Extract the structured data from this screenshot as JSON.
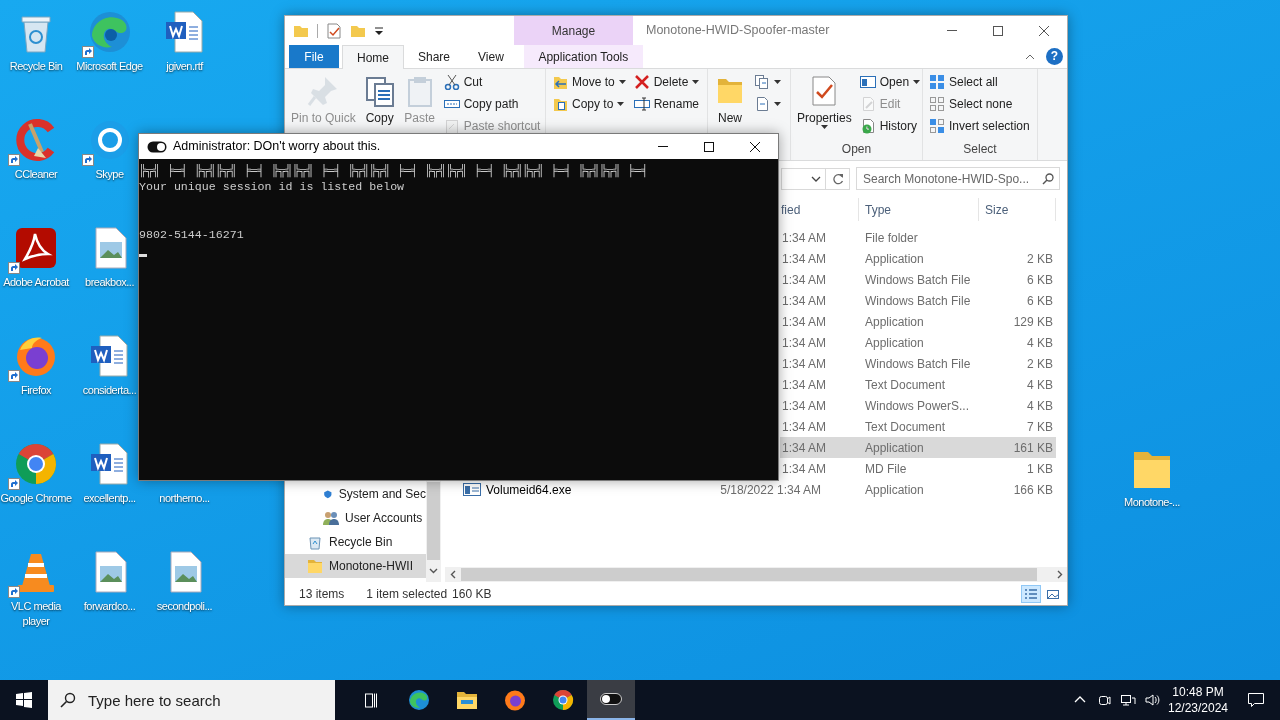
{
  "desktop_columns": [
    [
      {
        "label": "Recycle Bin",
        "kind": "recycle",
        "shortcut": false
      },
      {
        "label": "CCleaner",
        "kind": "ccleaner",
        "shortcut": true
      },
      {
        "label": "Adobe Acrobat",
        "kind": "acrobat",
        "shortcut": true
      },
      {
        "label": "Firefox",
        "kind": "firefox",
        "shortcut": true
      },
      {
        "label": "Google Chrome",
        "kind": "chrome",
        "shortcut": true
      },
      {
        "label": "VLC media player",
        "kind": "vlc",
        "shortcut": true
      }
    ],
    [
      {
        "label": "Microsoft Edge",
        "kind": "edge",
        "shortcut": true
      },
      {
        "label": "Skype",
        "kind": "skype",
        "shortcut": true
      },
      {
        "label": "breakbox...",
        "kind": "image",
        "shortcut": false
      },
      {
        "label": "considerta...",
        "kind": "word",
        "shortcut": false
      },
      {
        "label": "excellentp...",
        "kind": "word",
        "shortcut": false
      },
      {
        "label": "forwardco...",
        "kind": "image",
        "shortcut": false
      }
    ],
    [
      {
        "label": "jgiven.rtf",
        "kind": "word",
        "shortcut": false
      },
      {
        "label": "northerno..."
      },
      {
        "label": "secondpoli...",
        "kind": "image",
        "shortcut": false
      }
    ]
  ],
  "desktop_right_icon": {
    "label": "Monotone-...",
    "kind": "folder",
    "shortcut": false
  },
  "explorer": {
    "title": "Monotone-HWID-Spoofer-master",
    "context_group": "Manage",
    "tabs": [
      {
        "label": "File",
        "kind": "file",
        "selected": false
      },
      {
        "label": "Home",
        "kind": "tab",
        "selected": true
      },
      {
        "label": "Share",
        "kind": "tab",
        "selected": false
      },
      {
        "label": "View",
        "kind": "tab",
        "selected": false
      },
      {
        "label": "Application Tools",
        "kind": "context",
        "selected": false
      }
    ],
    "help_label": "?",
    "ribbon": [
      {
        "blocks": [
          {
            "kind": "large",
            "label": "Pin to Quick",
            "disabled": true,
            "dropdown": false
          },
          {
            "kind": "large",
            "label": "Copy",
            "disabled": false,
            "dropdown": false
          },
          {
            "kind": "large",
            "label": "Paste",
            "disabled": true,
            "dropdown": false
          },
          {
            "kind": "stack",
            "items": [
              {
                "label": "Cut",
                "disabled": false,
                "dropdown": false
              },
              {
                "label": "Copy path",
                "disabled": false,
                "dropdown": false
              },
              {
                "label": "Paste shortcut",
                "disabled": true,
                "dropdown": false
              }
            ]
          }
        ]
      },
      {
        "blocks": [
          {
            "kind": "stack",
            "items": [
              {
                "label": "Move to",
                "disabled": false,
                "dropdown": true
              },
              {
                "label": "Copy to",
                "disabled": false,
                "dropdown": true
              }
            ]
          },
          {
            "kind": "stack",
            "items": [
              {
                "label": "Delete",
                "disabled": false,
                "dropdown": true
              },
              {
                "label": "Rename",
                "disabled": false,
                "dropdown": false
              }
            ]
          }
        ]
      },
      {
        "blocks": [
          {
            "kind": "large",
            "label": "New",
            "disabled": false,
            "dropdown": false
          },
          {
            "kind": "stack",
            "items": [
              {
                "disabled": false,
                "dropdown": true
              },
              {
                "disabled": false,
                "dropdown": true
              }
            ]
          }
        ]
      },
      {
        "label": "Open",
        "blocks": [
          {
            "kind": "large",
            "label": "Properties",
            "disabled": false,
            "dropdown": true
          },
          {
            "kind": "stack",
            "items": [
              {
                "label": "Open",
                "disabled": false,
                "dropdown": true
              },
              {
                "label": "Edit",
                "disabled": true,
                "dropdown": false
              },
              {
                "label": "History",
                "disabled": false,
                "dropdown": false
              }
            ]
          }
        ]
      },
      {
        "label": "Select",
        "blocks": [
          {
            "kind": "stack",
            "items": [
              {
                "label": "Select all",
                "disabled": false,
                "dropdown": false
              },
              {
                "label": "Select none",
                "disabled": false,
                "dropdown": false
              },
              {
                "label": "Invert selection",
                "disabled": false,
                "dropdown": false
              }
            ]
          }
        ]
      }
    ],
    "search": {
      "placeholder": "Search Monotone-HWID-Spo..."
    },
    "columns": [
      "fied",
      "Type",
      "Size"
    ],
    "files": [
      {
        "modified": "1:34 AM",
        "type": "File folder",
        "selected": false
      },
      {
        "modified": "1:34 AM",
        "type": "Application",
        "size": "2 KB",
        "selected": false
      },
      {
        "modified": "1:34 AM",
        "type": "Windows Batch File",
        "size": "6 KB",
        "selected": false
      },
      {
        "modified": "1:34 AM",
        "type": "Windows Batch File",
        "size": "6 KB",
        "selected": false
      },
      {
        "modified": "1:34 AM",
        "type": "Application",
        "size": "129 KB",
        "selected": false
      },
      {
        "modified": "1:34 AM",
        "type": "Application",
        "size": "4 KB",
        "selected": false
      },
      {
        "modified": "1:34 AM",
        "type": "Windows Batch File",
        "size": "2 KB",
        "selected": false
      },
      {
        "modified": "1:34 AM",
        "type": "Text Document",
        "size": "4 KB",
        "selected": false
      },
      {
        "modified": "1:34 AM",
        "type": "Windows PowerS...",
        "size": "4 KB",
        "selected": false
      },
      {
        "modified": "1:34 AM",
        "type": "Text Document",
        "size": "7 KB",
        "selected": false
      },
      {
        "modified": "1:34 AM",
        "type": "Application",
        "size": "161 KB",
        "selected": true
      },
      {
        "modified": "1:34 AM",
        "type": "MD File",
        "size": "1 KB",
        "selected": false
      },
      {
        "name": "Volumeid64.exe",
        "modified": "5/18/2022 1:34 AM",
        "type": "Application",
        "size": "166 KB",
        "selected": false
      }
    ],
    "nav": [
      {
        "children": [
          {
            "label": "System and Sec",
            "selected": false
          },
          {
            "label": "User Accounts",
            "selected": false
          }
        ]
      },
      {
        "label": "Recycle Bin",
        "selected": false
      },
      {
        "label": "Monotone-HWII",
        "selected": true
      }
    ],
    "status": {
      "items": "13 items",
      "selection": "1 item selected",
      "size": "160 KB"
    },
    "views": [
      {
        "kind": "details",
        "selected": true
      },
      {
        "kind": "large",
        "selected": false
      }
    ]
  },
  "console": {
    "title": "Administrator:  DOn't worry about this.",
    "output": "╠╦╣ ╞═╡ ╠╦╣╠╦╣ ╞═╡ ╠╦╣╠╦╣ ╞═╡ ╠╦╣╠╦╣ ╞═╡ ╠╦╣╠╦╣ ╞═╡ ╠╦╣╠╦╣ ╞═╡ ╠╦╣╠╦╣ ╞═╡\nYour unique session id is listed below\n\n\n9802-5144-16271"
  },
  "taskbar": {
    "search_placeholder": "Type here to search",
    "apps": [
      {
        "kind": "taskview",
        "active": false
      },
      {
        "kind": "edge",
        "active": false
      },
      {
        "kind": "explorer",
        "active": false
      },
      {
        "kind": "firefox",
        "active": false
      },
      {
        "kind": "chrome",
        "active": false
      },
      {
        "kind": "console",
        "active": true
      }
    ],
    "time": "10:48 PM",
    "date": "12/23/2024"
  }
}
